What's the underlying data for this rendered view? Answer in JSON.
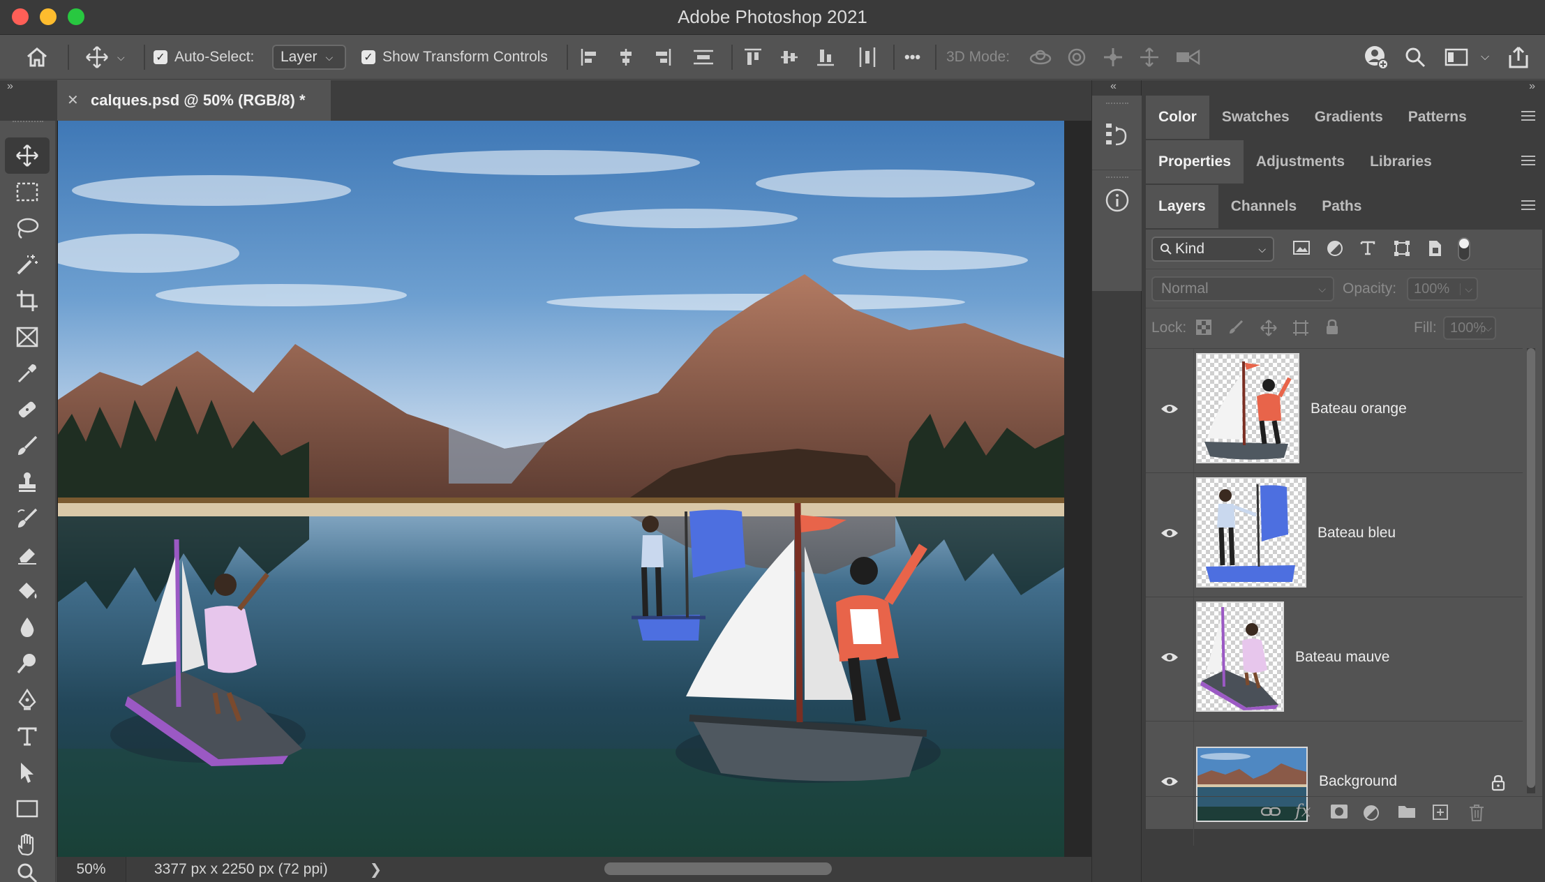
{
  "window": {
    "app_title": "Adobe Photoshop 2021"
  },
  "options_bar": {
    "auto_select_label": "Auto-Select:",
    "auto_select_checked": true,
    "auto_select_value": "Layer",
    "show_transform_label": "Show Transform Controls",
    "show_transform_checked": true,
    "three_d_mode_label": "3D Mode:",
    "more_label": "•••"
  },
  "document": {
    "tab_title": "calques.psd @ 50% (RGB/8) *",
    "zoom": "50%",
    "info": "3377 px x 2250 px (72 ppi)"
  },
  "tools": [
    "move-tool",
    "marquee-tool",
    "lasso-tool",
    "magic-wand-tool",
    "crop-tool",
    "frame-tool",
    "eyedropper-tool",
    "healing-brush-tool",
    "brush-tool",
    "clone-stamp-tool",
    "history-brush-tool",
    "eraser-tool",
    "paint-bucket-tool",
    "blur-tool",
    "dodge-tool",
    "pen-tool",
    "type-tool",
    "path-selection-tool",
    "rectangle-tool",
    "hand-tool",
    "zoom-tool"
  ],
  "panels": {
    "group1_tabs": [
      "Color",
      "Swatches",
      "Gradients",
      "Patterns"
    ],
    "group2_tabs": [
      "Properties",
      "Adjustments",
      "Libraries"
    ],
    "group3_tabs": [
      "Layers",
      "Channels",
      "Paths"
    ],
    "active": {
      "group1": "Color",
      "group2": "Properties",
      "group3": "Layers"
    }
  },
  "layers_panel": {
    "filter_kind": "Kind",
    "blend_mode": "Normal",
    "opacity_label": "Opacity:",
    "opacity_value": "100%",
    "lock_label": "Lock:",
    "fill_label": "Fill:",
    "fill_value": "100%",
    "layers": [
      {
        "name": "Bateau orange",
        "visible": true,
        "locked": false
      },
      {
        "name": "Bateau bleu",
        "visible": true,
        "locked": false
      },
      {
        "name": "Bateau mauve",
        "visible": true,
        "locked": false
      },
      {
        "name": "Background",
        "visible": true,
        "locked": true
      }
    ]
  },
  "colors": {
    "ui_dark": "#3d3d3d",
    "ui_mid": "#535353",
    "boat_orange_jacket": "#e8644a",
    "boat_blue_sail": "#4d6fe0",
    "boat_mauve_stripe": "#9b59c4"
  }
}
